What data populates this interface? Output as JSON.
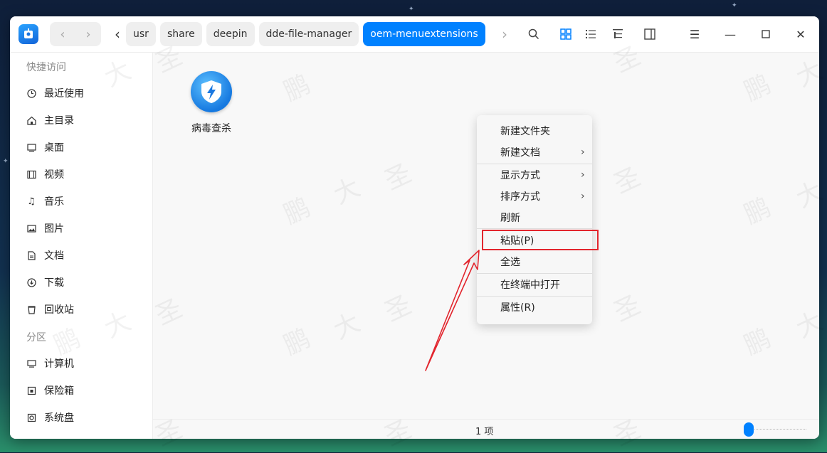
{
  "titlebar": {
    "breadcrumbs": [
      "usr",
      "share",
      "deepin",
      "dde-file-manager",
      "oem-menuextensions"
    ]
  },
  "sidebar": {
    "quick_access_title": "快捷访问",
    "quick_items": [
      {
        "label": "最近使用",
        "icon": "clock-icon"
      },
      {
        "label": "主目录",
        "icon": "home-icon"
      },
      {
        "label": "桌面",
        "icon": "desktop-icon"
      },
      {
        "label": "视频",
        "icon": "video-icon"
      },
      {
        "label": "音乐",
        "icon": "music-icon"
      },
      {
        "label": "图片",
        "icon": "picture-icon"
      },
      {
        "label": "文档",
        "icon": "document-icon"
      },
      {
        "label": "下载",
        "icon": "download-icon"
      },
      {
        "label": "回收站",
        "icon": "trash-icon"
      }
    ],
    "partition_title": "分区",
    "partition_items": [
      {
        "label": "计算机",
        "icon": "computer-icon"
      },
      {
        "label": "保险箱",
        "icon": "vault-icon"
      },
      {
        "label": "系统盘",
        "icon": "disk-icon"
      }
    ]
  },
  "files": [
    {
      "name": "病毒查杀",
      "icon": "shield-lightning-icon"
    }
  ],
  "statusbar": {
    "count": "1 项"
  },
  "context_menu": {
    "items": [
      {
        "label": "新建文件夹"
      },
      {
        "label": "新建文档",
        "submenu": true
      },
      {
        "label": "显示方式",
        "submenu": true
      },
      {
        "label": "排序方式",
        "submenu": true
      },
      {
        "label": "刷新"
      },
      {
        "label": "粘贴(P)",
        "highlighted": true
      },
      {
        "label": "全选"
      },
      {
        "label": "在终端中打开"
      },
      {
        "label": "属性(R)"
      }
    ]
  },
  "watermark": [
    "鹏",
    "大",
    "圣"
  ],
  "colors": {
    "accent": "#0081ff",
    "annotation": "#e2262e"
  }
}
